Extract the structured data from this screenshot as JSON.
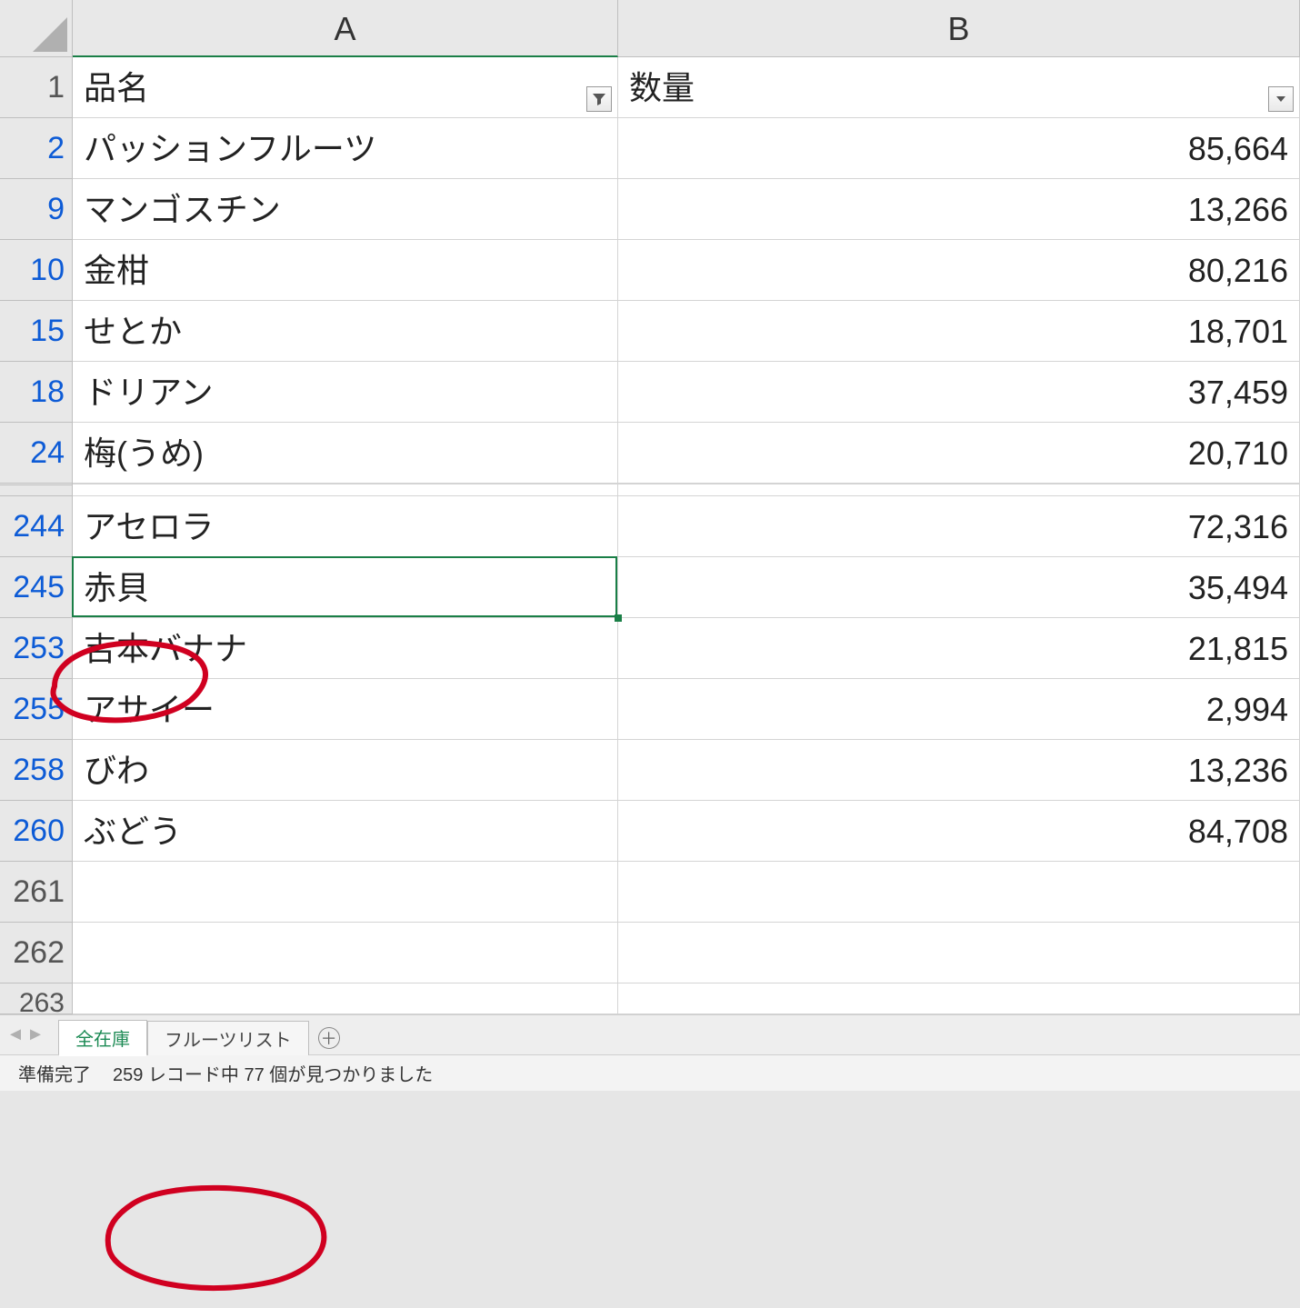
{
  "columns": {
    "A": "A",
    "B": "B"
  },
  "header_row": {
    "num": "1",
    "A": "品名",
    "B": "数量",
    "A_filter_active": true,
    "B_filter_active": false
  },
  "rows": [
    {
      "num": "2",
      "A": "パッションフルーツ",
      "B": "85,664"
    },
    {
      "num": "9",
      "A": "マンゴスチン",
      "B": "13,266"
    },
    {
      "num": "10",
      "A": "金柑",
      "B": "80,216"
    },
    {
      "num": "15",
      "A": "せとか",
      "B": "18,701"
    },
    {
      "num": "18",
      "A": "ドリアン",
      "B": "37,459"
    },
    {
      "num": "24",
      "A": "梅(うめ)",
      "B": "20,710"
    }
  ],
  "rows2": [
    {
      "num": "244",
      "A": "アセロラ",
      "B": "72,316"
    },
    {
      "num": "245",
      "A": "赤貝",
      "B": "35,494",
      "selected": true
    },
    {
      "num": "253",
      "A": "吉本バナナ",
      "B": "21,815"
    },
    {
      "num": "255",
      "A": "アサイー",
      "B": "2,994"
    },
    {
      "num": "258",
      "A": "びわ",
      "B": "13,236"
    },
    {
      "num": "260",
      "A": "ぶどう",
      "B": "84,708"
    }
  ],
  "rows3": [
    {
      "num": "261",
      "A": "",
      "B": ""
    },
    {
      "num": "262",
      "A": "",
      "B": ""
    }
  ],
  "partial_row": {
    "num": "263"
  },
  "sheet_tabs": {
    "active": "全在庫",
    "second": "フルーツリスト"
  },
  "status": {
    "ready": "準備完了",
    "filter_msg": "259 レコード中 77 個が見つかりました"
  },
  "selected_cell": "A245"
}
